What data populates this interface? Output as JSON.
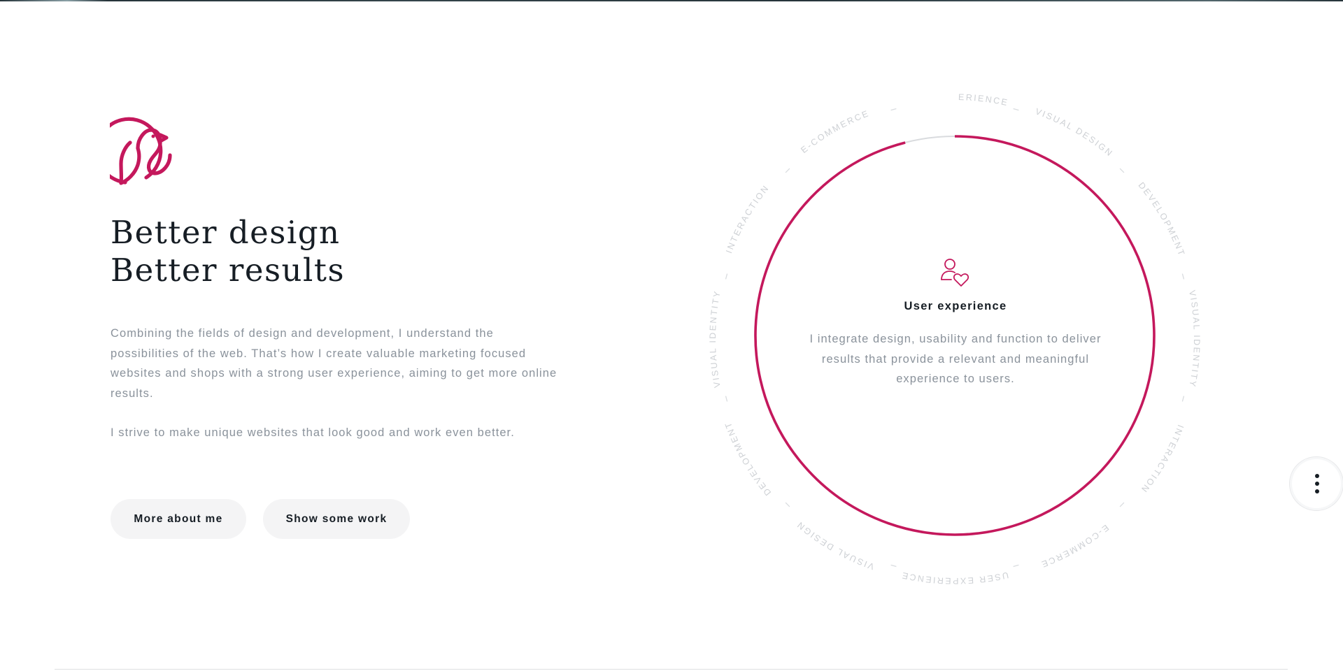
{
  "colors": {
    "accent": "#c4185c",
    "heading": "#161d24",
    "body_text": "#8a929b",
    "ring_label": "#cdd0d4",
    "button_bg": "#f4f4f5"
  },
  "brand": {
    "logo_icon": "bird-in-circle-icon"
  },
  "hero": {
    "headline_line1": "Better design",
    "headline_line2": "Better results",
    "paragraph1": "Combining the fields of design and development, I understand the possibilities of the web. That’s how I create valuable marketing focused websites and shops with a strong user experience, aiming to get more online results.",
    "paragraph2": "I strive to make unique websites that look good and work even better."
  },
  "buttons": {
    "about_label": "More about me",
    "work_label": "Show some work"
  },
  "skills_ring": {
    "labels": [
      "USER EXPERIENCE",
      "VISUAL DESIGN",
      "DEVELOPMENT",
      "VISUAL IDENTITY",
      "INTERACTION",
      "E-COMMERCE",
      "USER EXPERIENCE",
      "VISUAL DESIGN",
      "DEVELOPMENT",
      "VISUAL IDENTITY",
      "INTERACTION",
      "E-COMMERCE"
    ],
    "progress": 0.96,
    "active": {
      "icon": "user-heart-icon",
      "title": "User experience",
      "description": "I integrate design, usability and function to deliver results that provide a relevant and meaningful experience to users."
    }
  },
  "menu": {
    "icon": "vertical-dots-icon"
  }
}
